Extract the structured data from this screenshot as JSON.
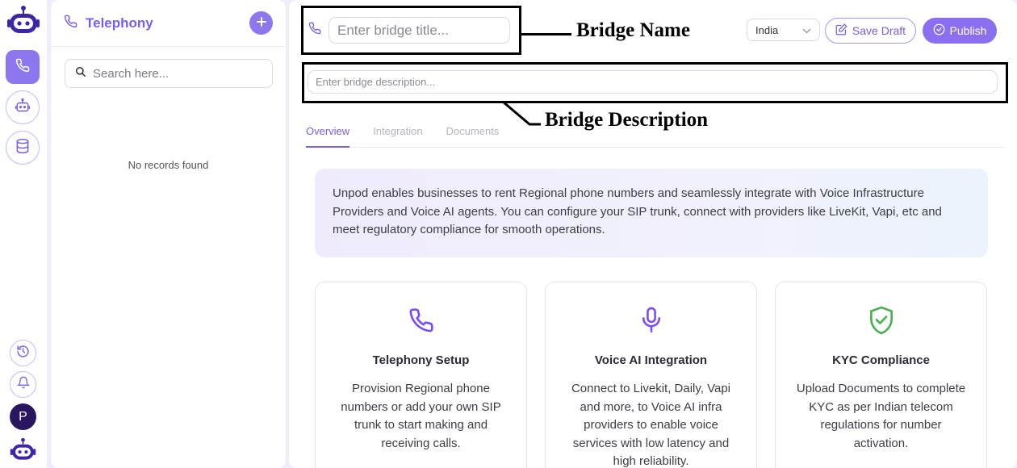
{
  "rail": {
    "bottom_avatar_initial": "P"
  },
  "panel": {
    "title": "Telephony",
    "search_placeholder": "Search here...",
    "empty_text": "No records found"
  },
  "header": {
    "title_placeholder": "Enter bridge title...",
    "description_placeholder": "Enter bridge description...",
    "country": "India",
    "save_draft_label": "Save Draft",
    "publish_label": "Publish"
  },
  "annotations": {
    "name_label": "Bridge Name",
    "description_label": "Bridge Description"
  },
  "tabs": [
    {
      "label": "Overview",
      "active": true
    },
    {
      "label": "Integration",
      "active": false
    },
    {
      "label": "Documents",
      "active": false
    }
  ],
  "info": {
    "text": "Unpod enables businesses to rent Regional phone numbers and seamlessly integrate with Voice Infrastructure Providers and Voice AI agents. You can configure your SIP trunk, connect with providers like LiveKit, Vapi, etc and meet regulatory compliance for smooth operations."
  },
  "cards": [
    {
      "icon": "phone-icon",
      "title": "Telephony Setup",
      "text": "Provision Regional phone numbers or add your own SIP trunk to start making and receiving calls."
    },
    {
      "icon": "microphone-icon",
      "title": "Voice AI Integration",
      "text": "Connect to Livekit, Daily, Vapi and more, to Voice AI infra providers to enable voice services with low latency and high reliability."
    },
    {
      "icon": "shield-check-icon",
      "title": "KYC Compliance",
      "text": "Upload Documents to complete KYC as per Indian telecom regulations for number activation."
    }
  ],
  "colors": {
    "accent": "#8a6ff0",
    "shield": "#4caf50"
  }
}
